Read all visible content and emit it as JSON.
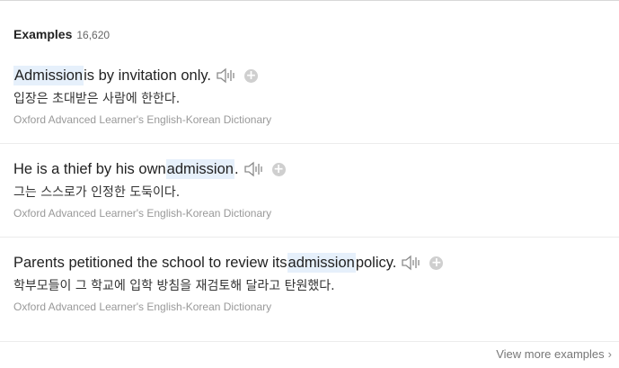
{
  "header": {
    "title": "Examples",
    "count": "16,620"
  },
  "examples": [
    {
      "en_before": "",
      "en_highlight": "Admission",
      "en_after": " is by invitation only.",
      "ko": "입장은 초대받은 사람에 한한다.",
      "source": "Oxford Advanced Learner's English-Korean Dictionary"
    },
    {
      "en_before": "He is a thief by his own ",
      "en_highlight": "admission",
      "en_after": ".",
      "ko": "그는 스스로가 인정한 도둑이다.",
      "source": "Oxford Advanced Learner's English-Korean Dictionary"
    },
    {
      "en_before": "Parents petitioned the school to review its ",
      "en_highlight": "admission",
      "en_after": " policy.",
      "ko": "학부모들이 그 학교에 입학 방침을 재검토해 달라고 탄원했다.",
      "source": "Oxford Advanced Learner's English-Korean Dictionary"
    }
  ],
  "footer": {
    "view_more_label": "View more examples"
  },
  "icons": {
    "speaker": "speaker-icon",
    "add": "add-icon",
    "chevron": "chevron-right-icon"
  },
  "colors": {
    "highlight": "#e6f0fb",
    "icon_gray": "#cfcfcf"
  }
}
